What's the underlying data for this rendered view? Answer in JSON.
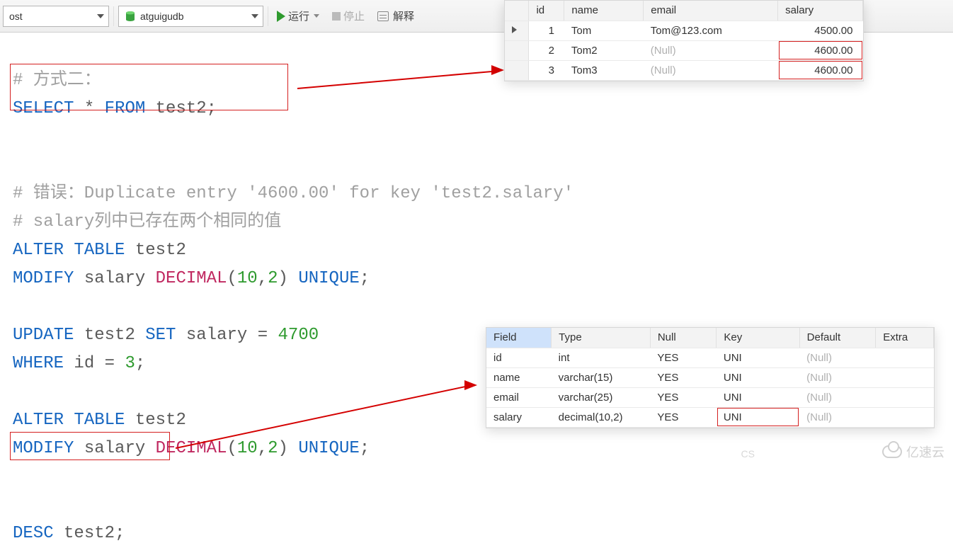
{
  "toolbar": {
    "host_value": "ost",
    "db_value": "atguigudb",
    "run_label": "运行",
    "stop_label": "停止",
    "explain_label": "解释"
  },
  "sql": {
    "cmt1": "# 方式二：",
    "select": "SELECT",
    "star": "*",
    "from": "FROM",
    "t_test2": "test2",
    "semi": ";",
    "cmt2": "# 错误：Duplicate entry '4600.00' for key 'test2.salary'",
    "cmt3": "# salary列中已存在两个相同的值",
    "alter": "ALTER",
    "table": "TABLE",
    "modify": "MODIFY",
    "salary": "salary",
    "decimal": "DECIMAL",
    "lp": "(",
    "n10": "10",
    "comma": ",",
    "n2": "2",
    "rp": ")",
    "unique": "UNIQUE",
    "update": "UPDATE",
    "set": "SET",
    "eq": "=",
    "n4700": "4700",
    "where": "WHERE",
    "id": "id",
    "n3": "3",
    "desc": "DESC"
  },
  "result1": {
    "headers": {
      "c0": "id",
      "c1": "name",
      "c2": "email",
      "c3": "salary"
    },
    "rows": [
      {
        "id": "1",
        "name": "Tom",
        "email": "Tom@123.com",
        "salary": "4500.00",
        "gutter": "tri"
      },
      {
        "id": "2",
        "name": "Tom2",
        "email": "(Null)",
        "salary": "4600.00",
        "gutter": ""
      },
      {
        "id": "3",
        "name": "Tom3",
        "email": "(Null)",
        "salary": "4600.00",
        "gutter": ""
      }
    ]
  },
  "result2": {
    "headers": {
      "c0": "Field",
      "c1": "Type",
      "c2": "Null",
      "c3": "Key",
      "c4": "Default",
      "c5": "Extra"
    },
    "rows": [
      {
        "field": "id",
        "type": "int",
        "null": "YES",
        "key": "UNI",
        "def": "(Null)",
        "extra": ""
      },
      {
        "field": "name",
        "type": "varchar(15)",
        "null": "YES",
        "key": "UNI",
        "def": "(Null)",
        "extra": ""
      },
      {
        "field": "email",
        "type": "varchar(25)",
        "null": "YES",
        "key": "UNI",
        "def": "(Null)",
        "extra": ""
      },
      {
        "field": "salary",
        "type": "decimal(10,2)",
        "null": "YES",
        "key": "UNI",
        "def": "(Null)",
        "extra": ""
      }
    ]
  },
  "watermark": {
    "text": "亿速云",
    "cs": "CS"
  }
}
